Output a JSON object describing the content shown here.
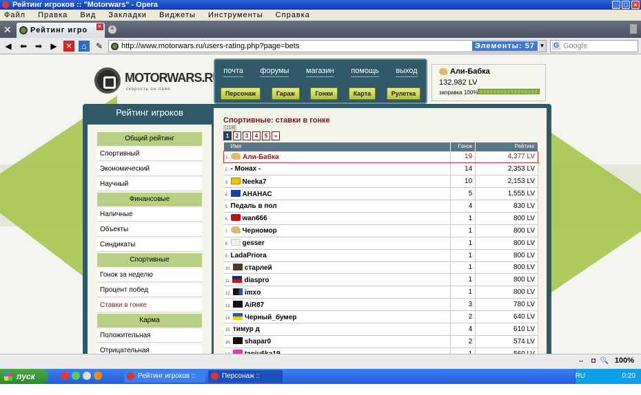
{
  "window": {
    "title": "Рейтинг игроков :: \"Motorwars\" - Opera"
  },
  "menu": [
    "Файл",
    "Правка",
    "Вид",
    "Закладки",
    "Виджеты",
    "Инструменты",
    "Справка"
  ],
  "tab": {
    "label": "Рейтинг игро"
  },
  "address": {
    "url": "http://www.motorwars.ru/users-rating.php?page=bets",
    "elements": "Элементы: 57",
    "search_placeholder": "Google"
  },
  "site": {
    "logo": "MOTORWARS.RU",
    "logo_sub": "скорость он-лайн",
    "nav_top": [
      "почта",
      "форумы",
      "магазин",
      "помощь",
      "выход"
    ],
    "nav_bottom": [
      "Персонаж",
      "Гараж",
      "Гонки",
      "Карта",
      "Рулетка"
    ],
    "user": {
      "name": "Али-Бабка",
      "money": "132,982 LV",
      "fuel_label": "заправка 100%",
      "fuel": 1.0
    }
  },
  "sidebar": {
    "title": "Рейтинг игроков",
    "sections": [
      {
        "header": "Общий рейтинг",
        "items": [
          "Спортивный",
          "Экономический",
          "Научный"
        ]
      },
      {
        "header": "Финансовые",
        "items": [
          "Наличные",
          "Объекты",
          "Синдикаты"
        ]
      },
      {
        "header": "Спортивные",
        "items": [
          "Гонок за неделю",
          "Процент побед",
          "Ставки в гонке"
        ]
      },
      {
        "header": "Карма",
        "items": [
          "Положительная",
          "Отрицательная"
        ]
      }
    ],
    "active": "Ставки в гонке"
  },
  "content": {
    "title": "Спортивные: ставки в гонке",
    "count": "[118]",
    "pages": [
      "1",
      "2",
      "3",
      "4",
      "5",
      "»"
    ],
    "columns": [
      "Имя",
      "Гонок",
      "Рейтинг"
    ],
    "rows": [
      {
        "n": "1.",
        "name": "Али-Бабка",
        "races": "19",
        "rating": "4,377 LV",
        "icon": "hand"
      },
      {
        "n": "2.",
        "name": "- Монах -",
        "races": "14",
        "rating": "2,353 LV",
        "icon": ""
      },
      {
        "n": "3.",
        "name": "Neeka7",
        "races": "10",
        "rating": "2,153 LV",
        "icon": "yellow"
      },
      {
        "n": "4.",
        "name": "АНАНАС",
        "races": "5",
        "rating": "1,555 LV",
        "icon": "eu"
      },
      {
        "n": "5.",
        "name": "Педаль в пол",
        "races": "4",
        "rating": "830 LV",
        "icon": ""
      },
      {
        "n": "6.",
        "name": "wan666",
        "races": "1",
        "rating": "800 LV",
        "icon": "red"
      },
      {
        "n": "7.",
        "name": "Черномор",
        "races": "1",
        "rating": "800 LV",
        "icon": "hand"
      },
      {
        "n": "8.",
        "name": "gesser",
        "races": "1",
        "rating": "800 LV",
        "icon": "white"
      },
      {
        "n": "9.",
        "name": "LadaPriora",
        "races": "1",
        "rating": "800 LV",
        "icon": ""
      },
      {
        "n": "10.",
        "name": "старлей",
        "races": "1",
        "rating": "800 LV",
        "icon": "dark"
      },
      {
        "n": "11.",
        "name": "diaspro",
        "races": "1",
        "rating": "800 LV",
        "icon": "flag"
      },
      {
        "n": "12.",
        "name": "imxo",
        "races": "1",
        "rating": "800 LV",
        "icon": "blackblue"
      },
      {
        "n": "13.",
        "name": "AiR87",
        "races": "3",
        "rating": "780 LV",
        "icon": "pirate"
      },
      {
        "n": "14.",
        "name": "Черный_бумер",
        "races": "2",
        "rating": "640 LV",
        "icon": "ua"
      },
      {
        "n": "15.",
        "name": "тимур д",
        "races": "4",
        "rating": "610 LV",
        "icon": ""
      },
      {
        "n": "16.",
        "name": "shapar0",
        "races": "2",
        "rating": "574 LV",
        "icon": "pirate"
      },
      {
        "n": "17.",
        "name": "tanju6ka19",
        "races": "1",
        "rating": "560 LV",
        "icon": "pink"
      }
    ]
  },
  "status": {
    "zoom": "100%"
  },
  "taskbar": {
    "start": "пуск",
    "tasks": [
      "Рейтинг игроков :: \"...",
      "Персонаж :: \"Motorw..."
    ],
    "lang": "RU",
    "time": "0:20"
  }
}
